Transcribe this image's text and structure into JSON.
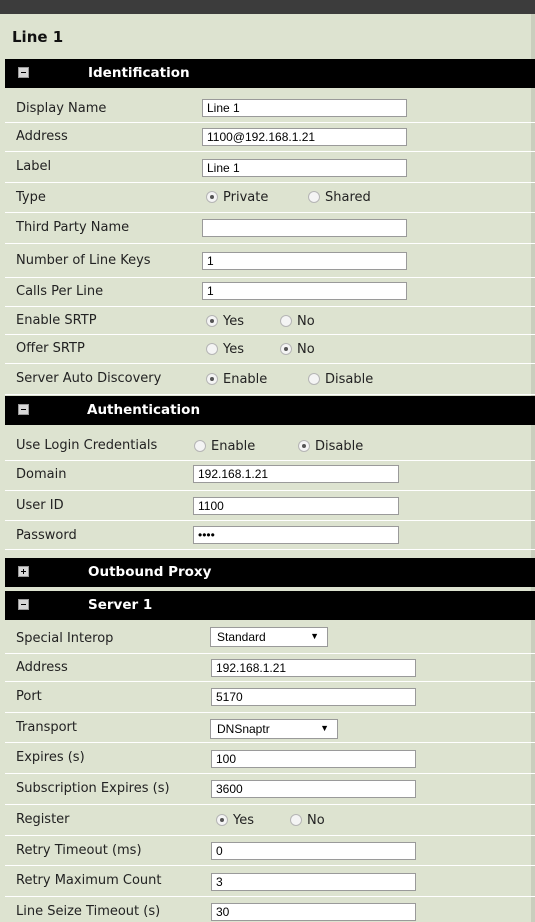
{
  "page": {
    "title": "Line 1"
  },
  "identification": {
    "header": "Identification",
    "display_name": {
      "label": "Display Name",
      "value": "Line 1"
    },
    "address": {
      "label": "Address",
      "value": "1100@192.168.1.21"
    },
    "label_field": {
      "label": "Label",
      "value": "Line 1"
    },
    "type": {
      "label": "Type",
      "opt1": "Private",
      "opt2": "Shared",
      "selected": "Private"
    },
    "third_party_name": {
      "label": "Third Party Name",
      "value": ""
    },
    "line_keys": {
      "label": "Number of Line Keys",
      "value": "1"
    },
    "calls_per_line": {
      "label": "Calls Per Line",
      "value": "1"
    },
    "enable_srtp": {
      "label": "Enable SRTP",
      "opt1": "Yes",
      "opt2": "No",
      "selected": "Yes"
    },
    "offer_srtp": {
      "label": "Offer SRTP",
      "opt1": "Yes",
      "opt2": "No",
      "selected": "No"
    },
    "auto_discovery": {
      "label": "Server Auto Discovery",
      "opt1": "Enable",
      "opt2": "Disable",
      "selected": "Enable"
    }
  },
  "authentication": {
    "header": "Authentication",
    "login_credentials": {
      "label": "Use Login Credentials",
      "opt1": "Enable",
      "opt2": "Disable",
      "selected": "Disable"
    },
    "domain": {
      "label": "Domain",
      "value": "192.168.1.21"
    },
    "user_id": {
      "label": "User ID",
      "value": "1100"
    },
    "password": {
      "label": "Password",
      "value": "••••"
    }
  },
  "outbound_proxy": {
    "header": "Outbound Proxy"
  },
  "server1": {
    "header": "Server 1",
    "special_interop": {
      "label": "Special Interop",
      "value": "Standard"
    },
    "address": {
      "label": "Address",
      "value": "192.168.1.21"
    },
    "port": {
      "label": "Port",
      "value": "5170"
    },
    "transport": {
      "label": "Transport",
      "value": "DNSnaptr"
    },
    "expires": {
      "label": "Expires (s)",
      "value": "100"
    },
    "subscription_expires": {
      "label": "Subscription Expires (s)",
      "value": "3600"
    },
    "register": {
      "label": "Register",
      "opt1": "Yes",
      "opt2": "No",
      "selected": "Yes"
    },
    "retry_timeout": {
      "label": "Retry Timeout (ms)",
      "value": "0"
    },
    "retry_max_count": {
      "label": "Retry Maximum Count",
      "value": "3"
    },
    "line_seize_timeout": {
      "label": "Line Seize Timeout (s)",
      "value": "30"
    }
  },
  "icons": {
    "collapse": "minus-square-icon",
    "expand": "plus-square-icon",
    "dropdown": "triangle-down-icon"
  }
}
